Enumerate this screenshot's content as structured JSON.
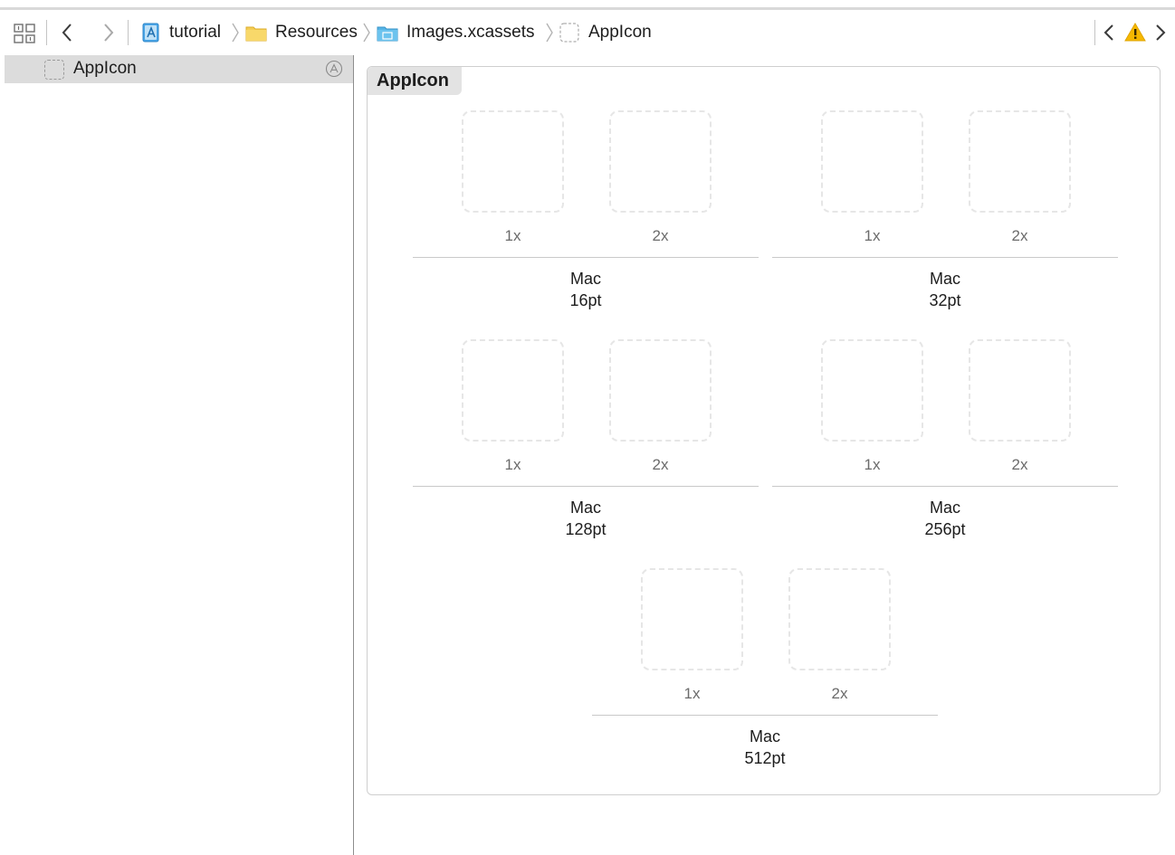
{
  "jumpbar": {
    "breadcrumbs": [
      {
        "label": "tutorial",
        "icon": "project-icon"
      },
      {
        "label": "Resources",
        "icon": "folder-icon"
      },
      {
        "label": "Images.xcassets",
        "icon": "asset-catalog-icon"
      },
      {
        "label": "AppIcon",
        "icon": "appicon-set-icon"
      }
    ]
  },
  "sidebar": {
    "items": [
      {
        "label": "AppIcon",
        "selected": true
      }
    ]
  },
  "editor": {
    "set_name": "AppIcon",
    "groups": [
      {
        "platform": "Mac",
        "size": "16pt",
        "scales": [
          "1x",
          "2x"
        ]
      },
      {
        "platform": "Mac",
        "size": "32pt",
        "scales": [
          "1x",
          "2x"
        ]
      },
      {
        "platform": "Mac",
        "size": "128pt",
        "scales": [
          "1x",
          "2x"
        ]
      },
      {
        "platform": "Mac",
        "size": "256pt",
        "scales": [
          "1x",
          "2x"
        ]
      },
      {
        "platform": "Mac",
        "size": "512pt",
        "scales": [
          "1x",
          "2x"
        ]
      }
    ]
  },
  "colors": {
    "warning": "#f6b800",
    "selection": "#dcdcdc",
    "folder": "#f5cd55",
    "catalog": "#55b4e6"
  }
}
